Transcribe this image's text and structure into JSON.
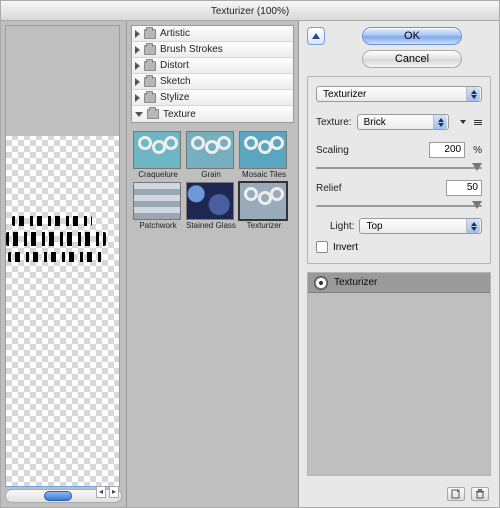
{
  "window": {
    "title": "Texturizer (100%)"
  },
  "buttons": {
    "ok": "OK",
    "cancel": "Cancel"
  },
  "categories": {
    "artistic": "Artistic",
    "brush_strokes": "Brush Strokes",
    "distort": "Distort",
    "sketch": "Sketch",
    "stylize": "Stylize",
    "texture": "Texture"
  },
  "thumbs": {
    "craquelure": "Craquelure",
    "grain": "Grain",
    "mosaic_tiles": "Mosaic Tiles",
    "patchwork": "Patchwork",
    "stained_glass": "Stained Glass",
    "texturizer": "Texturizer"
  },
  "settings": {
    "filter_name": "Texturizer",
    "texture_label": "Texture:",
    "texture_value": "Brick",
    "scaling_label": "Scaling",
    "scaling_value": "200",
    "scaling_unit": "%",
    "relief_label": "Relief",
    "relief_value": "50",
    "light_label": "Light:",
    "light_value": "Top",
    "invert_label": "Invert",
    "invert_checked": false
  },
  "layers": {
    "item0": "Texturizer"
  }
}
